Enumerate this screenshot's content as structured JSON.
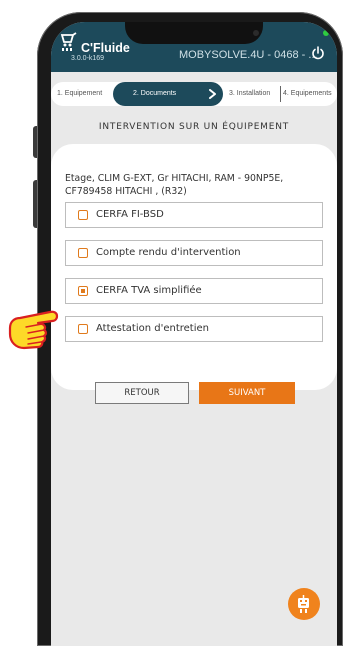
{
  "app": {
    "brand": "C'Fluide",
    "version": "3.0.0-k169",
    "device_label": "MOBYSOLVE.4U - 0468 - ..."
  },
  "stepper": {
    "steps": [
      {
        "label": "1. Equipement",
        "active": false
      },
      {
        "label": "2. Documents",
        "active": true
      },
      {
        "label": "3. Installation",
        "active": false
      },
      {
        "label": "4. Equipements",
        "active": false
      }
    ]
  },
  "page": {
    "title": "INTERVENTION SUR UN ÉQUIPEMENT"
  },
  "equipment": {
    "description": "Etage, CLIM G-EXT, Gr HITACHI, RAM - 90NP5E, CF789458 HITACHI , (R32)"
  },
  "documents": [
    {
      "label": "CERFA FI-BSD",
      "checked": false
    },
    {
      "label": "Compte rendu d'intervention",
      "checked": false
    },
    {
      "label": "CERFA TVA simplifiée",
      "checked": true
    },
    {
      "label": "Attestation d'entretien",
      "checked": false
    }
  ],
  "actions": {
    "back_label": "RETOUR",
    "next_label": "SUIVANT"
  },
  "colors": {
    "header": "#1d4a5b",
    "accent": "#e87617",
    "status": "#2ecc40"
  },
  "icons": {
    "logo": "cfluide-logo-icon",
    "power": "power-icon",
    "step_next": "chevron-right-icon",
    "fab": "assistant-icon",
    "pointer": "pointing-hand-icon"
  }
}
